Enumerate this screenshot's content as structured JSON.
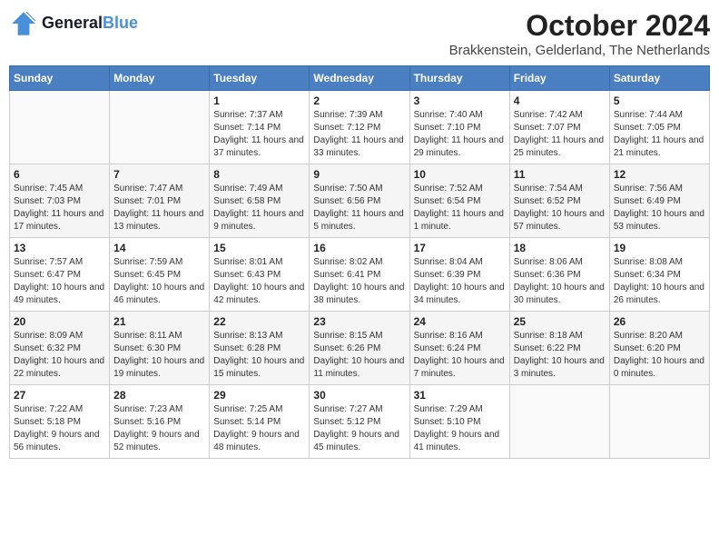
{
  "header": {
    "logo_line1": "General",
    "logo_line2": "Blue",
    "month": "October 2024",
    "location": "Brakkenstein, Gelderland, The Netherlands"
  },
  "weekdays": [
    "Sunday",
    "Monday",
    "Tuesday",
    "Wednesday",
    "Thursday",
    "Friday",
    "Saturday"
  ],
  "weeks": [
    [
      {
        "day": "",
        "info": ""
      },
      {
        "day": "",
        "info": ""
      },
      {
        "day": "1",
        "info": "Sunrise: 7:37 AM\nSunset: 7:14 PM\nDaylight: 11 hours and 37 minutes."
      },
      {
        "day": "2",
        "info": "Sunrise: 7:39 AM\nSunset: 7:12 PM\nDaylight: 11 hours and 33 minutes."
      },
      {
        "day": "3",
        "info": "Sunrise: 7:40 AM\nSunset: 7:10 PM\nDaylight: 11 hours and 29 minutes."
      },
      {
        "day": "4",
        "info": "Sunrise: 7:42 AM\nSunset: 7:07 PM\nDaylight: 11 hours and 25 minutes."
      },
      {
        "day": "5",
        "info": "Sunrise: 7:44 AM\nSunset: 7:05 PM\nDaylight: 11 hours and 21 minutes."
      }
    ],
    [
      {
        "day": "6",
        "info": "Sunrise: 7:45 AM\nSunset: 7:03 PM\nDaylight: 11 hours and 17 minutes."
      },
      {
        "day": "7",
        "info": "Sunrise: 7:47 AM\nSunset: 7:01 PM\nDaylight: 11 hours and 13 minutes."
      },
      {
        "day": "8",
        "info": "Sunrise: 7:49 AM\nSunset: 6:58 PM\nDaylight: 11 hours and 9 minutes."
      },
      {
        "day": "9",
        "info": "Sunrise: 7:50 AM\nSunset: 6:56 PM\nDaylight: 11 hours and 5 minutes."
      },
      {
        "day": "10",
        "info": "Sunrise: 7:52 AM\nSunset: 6:54 PM\nDaylight: 11 hours and 1 minute."
      },
      {
        "day": "11",
        "info": "Sunrise: 7:54 AM\nSunset: 6:52 PM\nDaylight: 10 hours and 57 minutes."
      },
      {
        "day": "12",
        "info": "Sunrise: 7:56 AM\nSunset: 6:49 PM\nDaylight: 10 hours and 53 minutes."
      }
    ],
    [
      {
        "day": "13",
        "info": "Sunrise: 7:57 AM\nSunset: 6:47 PM\nDaylight: 10 hours and 49 minutes."
      },
      {
        "day": "14",
        "info": "Sunrise: 7:59 AM\nSunset: 6:45 PM\nDaylight: 10 hours and 46 minutes."
      },
      {
        "day": "15",
        "info": "Sunrise: 8:01 AM\nSunset: 6:43 PM\nDaylight: 10 hours and 42 minutes."
      },
      {
        "day": "16",
        "info": "Sunrise: 8:02 AM\nSunset: 6:41 PM\nDaylight: 10 hours and 38 minutes."
      },
      {
        "day": "17",
        "info": "Sunrise: 8:04 AM\nSunset: 6:39 PM\nDaylight: 10 hours and 34 minutes."
      },
      {
        "day": "18",
        "info": "Sunrise: 8:06 AM\nSunset: 6:36 PM\nDaylight: 10 hours and 30 minutes."
      },
      {
        "day": "19",
        "info": "Sunrise: 8:08 AM\nSunset: 6:34 PM\nDaylight: 10 hours and 26 minutes."
      }
    ],
    [
      {
        "day": "20",
        "info": "Sunrise: 8:09 AM\nSunset: 6:32 PM\nDaylight: 10 hours and 22 minutes."
      },
      {
        "day": "21",
        "info": "Sunrise: 8:11 AM\nSunset: 6:30 PM\nDaylight: 10 hours and 19 minutes."
      },
      {
        "day": "22",
        "info": "Sunrise: 8:13 AM\nSunset: 6:28 PM\nDaylight: 10 hours and 15 minutes."
      },
      {
        "day": "23",
        "info": "Sunrise: 8:15 AM\nSunset: 6:26 PM\nDaylight: 10 hours and 11 minutes."
      },
      {
        "day": "24",
        "info": "Sunrise: 8:16 AM\nSunset: 6:24 PM\nDaylight: 10 hours and 7 minutes."
      },
      {
        "day": "25",
        "info": "Sunrise: 8:18 AM\nSunset: 6:22 PM\nDaylight: 10 hours and 3 minutes."
      },
      {
        "day": "26",
        "info": "Sunrise: 8:20 AM\nSunset: 6:20 PM\nDaylight: 10 hours and 0 minutes."
      }
    ],
    [
      {
        "day": "27",
        "info": "Sunrise: 7:22 AM\nSunset: 5:18 PM\nDaylight: 9 hours and 56 minutes."
      },
      {
        "day": "28",
        "info": "Sunrise: 7:23 AM\nSunset: 5:16 PM\nDaylight: 9 hours and 52 minutes."
      },
      {
        "day": "29",
        "info": "Sunrise: 7:25 AM\nSunset: 5:14 PM\nDaylight: 9 hours and 48 minutes."
      },
      {
        "day": "30",
        "info": "Sunrise: 7:27 AM\nSunset: 5:12 PM\nDaylight: 9 hours and 45 minutes."
      },
      {
        "day": "31",
        "info": "Sunrise: 7:29 AM\nSunset: 5:10 PM\nDaylight: 9 hours and 41 minutes."
      },
      {
        "day": "",
        "info": ""
      },
      {
        "day": "",
        "info": ""
      }
    ]
  ]
}
